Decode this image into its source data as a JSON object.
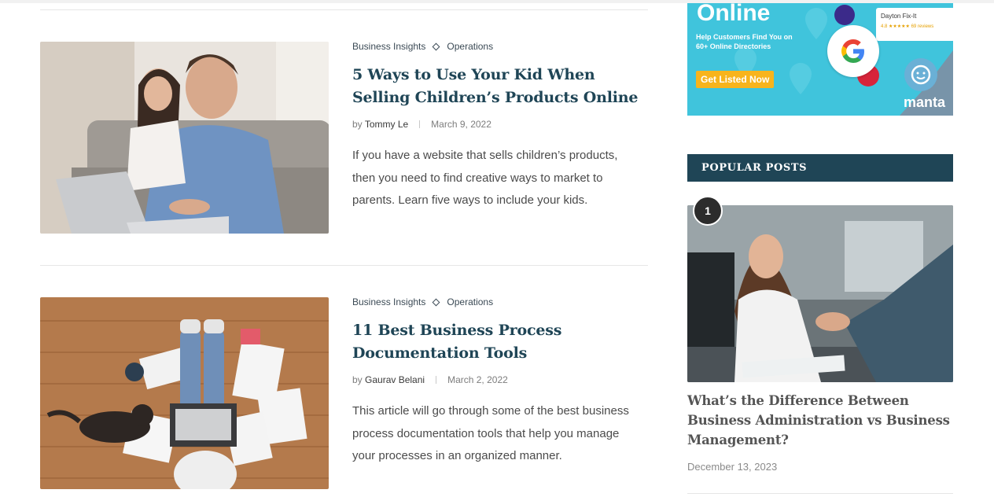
{
  "articles": [
    {
      "categories": [
        "Business Insights",
        "Operations"
      ],
      "title": "5 Ways to Use Your Kid When Selling Children’s Products Online",
      "by": "by",
      "author": "Tommy Le",
      "date": "March 9, 2022",
      "excerpt": "If you have a website that sells children’s products, then you need to find creative ways to market to parents. Learn five ways to include your kids."
    },
    {
      "categories": [
        "Business Insights",
        "Operations"
      ],
      "title": "11 Best Business Process Documentation Tools",
      "by": "by",
      "author": "Gaurav Belani",
      "date": "March 2, 2022",
      "excerpt": "This article will go through some of the best business process documentation tools that help you manage your processes in an organized manner."
    }
  ],
  "ad": {
    "headline": "Online",
    "subtext": "Help Customers Find You on 60+ Online Directories",
    "cta": "Get Listed Now",
    "brand": "manta",
    "listing_name": "Dayton Fix-It",
    "listing_rating": "4.8 ★★★★★ 69 reviews",
    "colors": {
      "background": "#40c4dc",
      "cta": "#f8b41c"
    }
  },
  "sidebar": {
    "popular_heading": "POPULAR POSTS",
    "popular": [
      {
        "rank": "1",
        "title": "What’s the Difference Between Business Administration vs Business Management?",
        "date": "December 13, 2023"
      }
    ]
  },
  "colors": {
    "title": "#1f4556",
    "heading_bg": "#1f4556"
  }
}
